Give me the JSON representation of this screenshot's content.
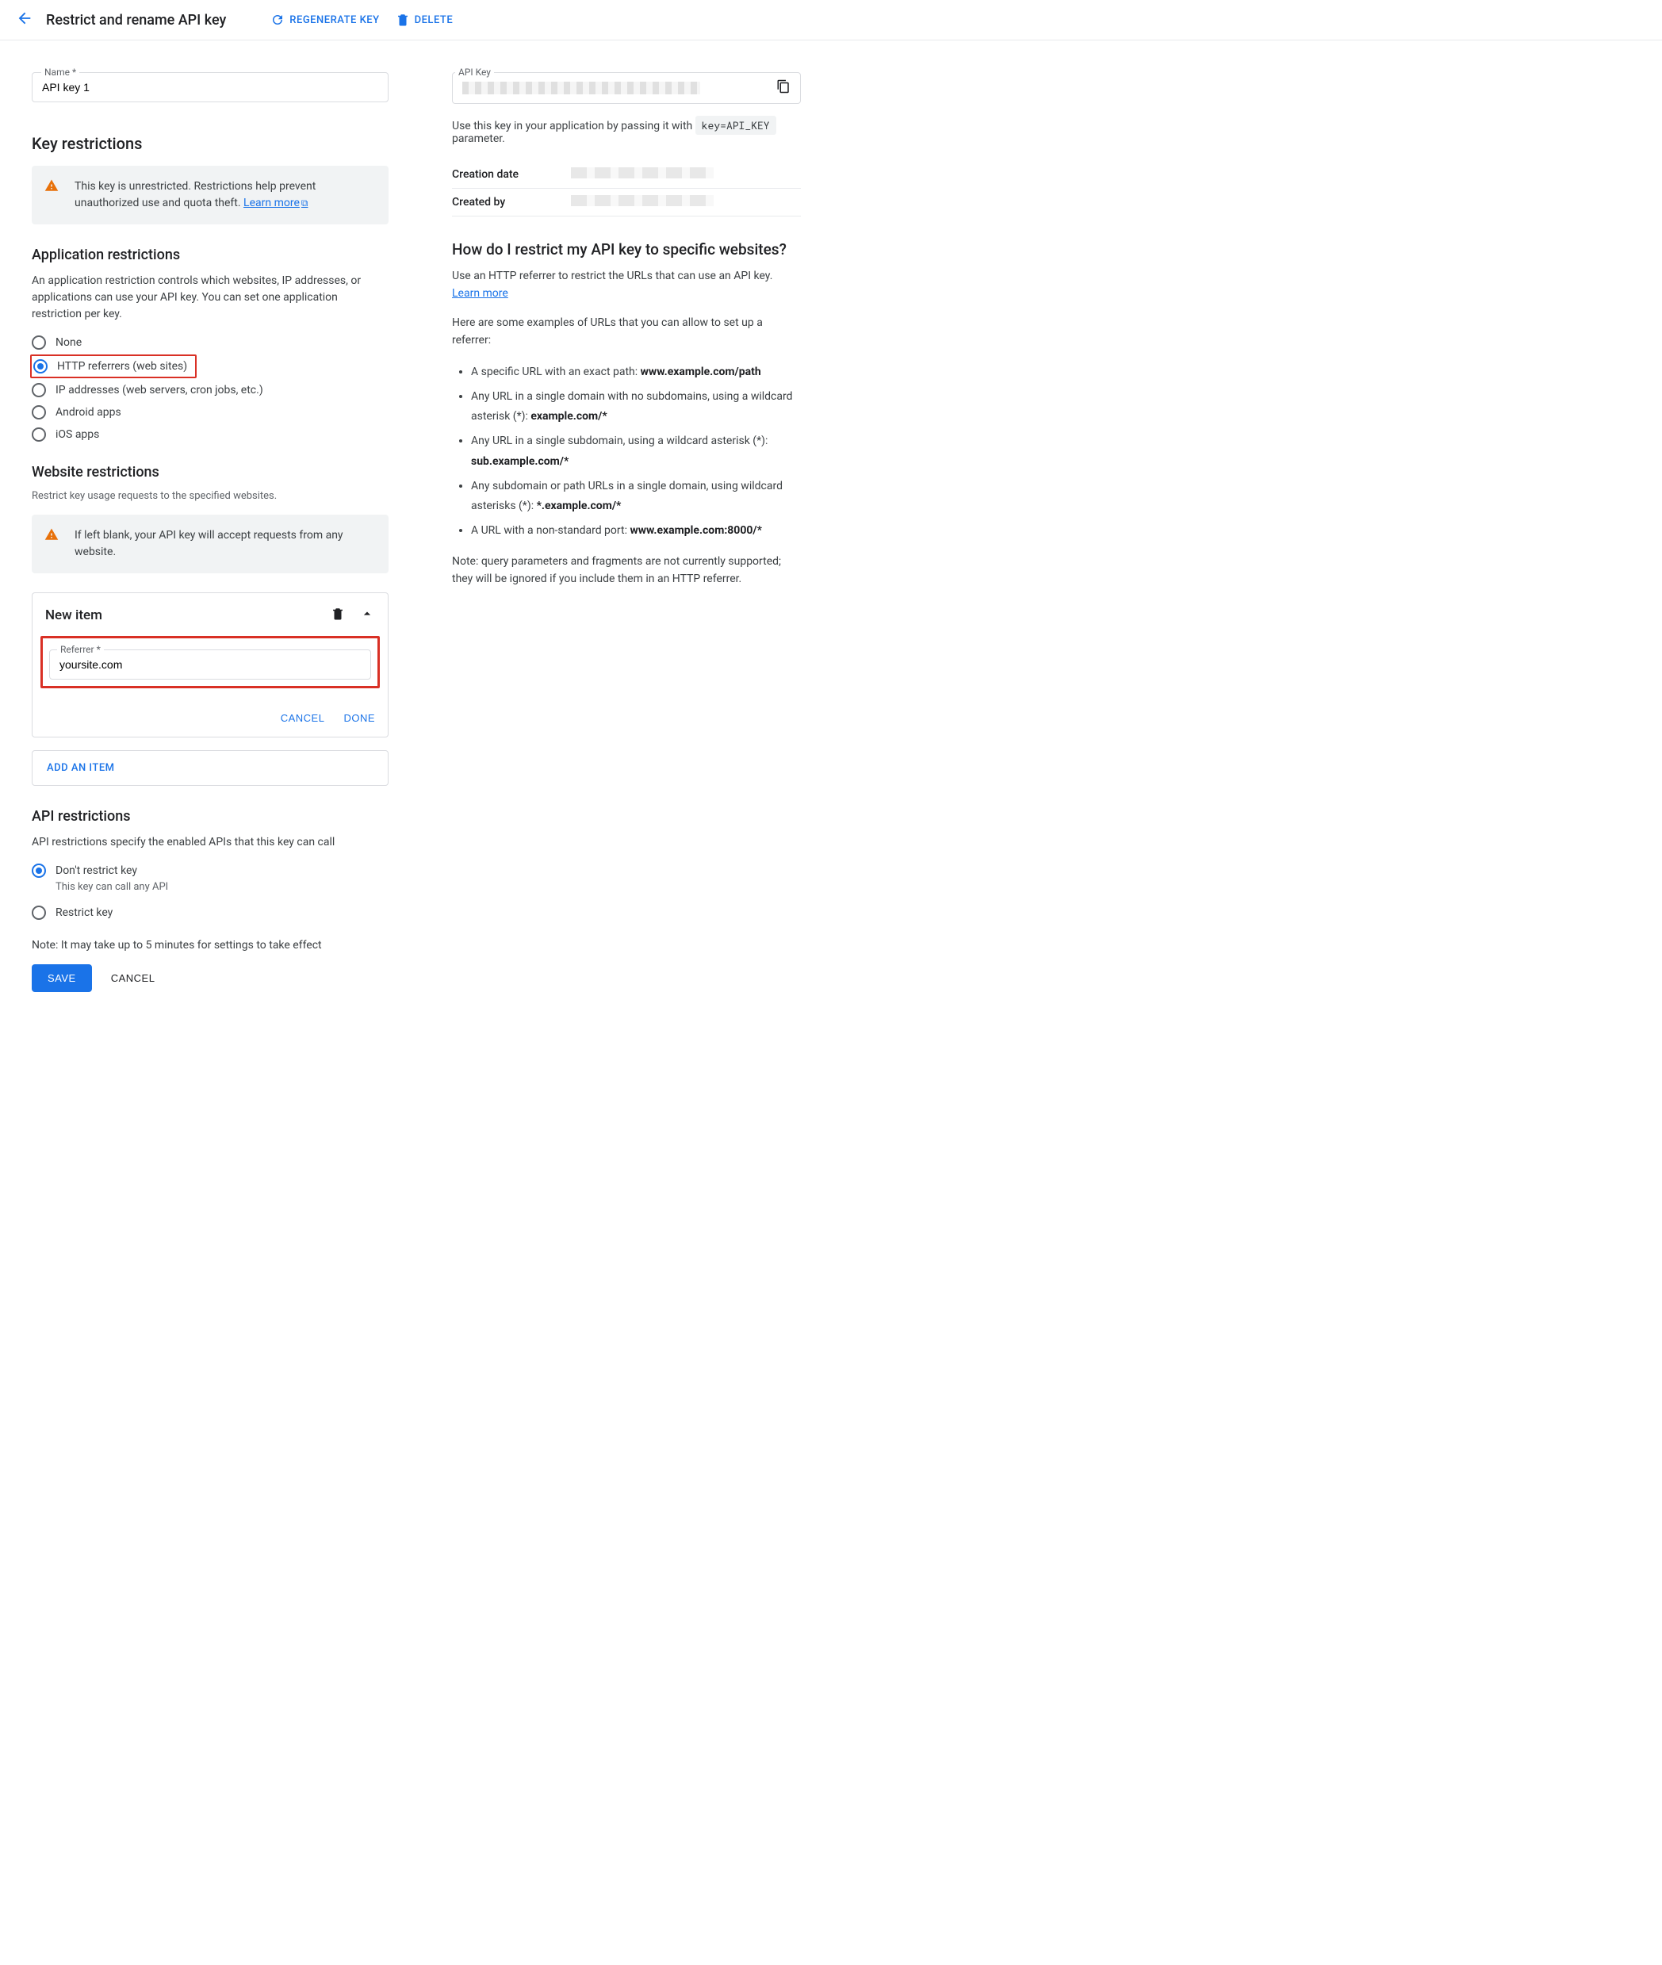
{
  "header": {
    "title": "Restrict and rename API key",
    "regenerate": "REGENERATE KEY",
    "delete": "DELETE"
  },
  "name_field": {
    "label": "Name *",
    "value": "API key 1"
  },
  "key_restrictions": {
    "heading": "Key restrictions",
    "warning_text": "This key is unrestricted. Restrictions help prevent unauthorized use and quota theft. ",
    "learn_more": "Learn more"
  },
  "app_restrictions": {
    "heading": "Application restrictions",
    "desc": "An application restriction controls which websites, IP addresses, or applications can use your API key. You can set one application restriction per key.",
    "options": [
      {
        "label": "None",
        "checked": false
      },
      {
        "label": "HTTP referrers (web sites)",
        "checked": true,
        "highlighted": true
      },
      {
        "label": "IP addresses (web servers, cron jobs, etc.)",
        "checked": false
      },
      {
        "label": "Android apps",
        "checked": false
      },
      {
        "label": "iOS apps",
        "checked": false
      }
    ]
  },
  "website_restrictions": {
    "heading": "Website restrictions",
    "sub": "Restrict key usage requests to the specified websites.",
    "warning": "If left blank, your API key will accept requests from any website.",
    "new_item": {
      "title": "New item",
      "referrer_label": "Referrer *",
      "referrer_value": "yoursite.com",
      "cancel": "CANCEL",
      "done": "DONE"
    },
    "add_item": "ADD AN ITEM"
  },
  "api_restrictions": {
    "heading": "API restrictions",
    "desc": "API restrictions specify the enabled APIs that this key can call",
    "options": [
      {
        "label": "Don't restrict key",
        "sub": "This key can call any API",
        "checked": true
      },
      {
        "label": "Restrict key",
        "checked": false
      }
    ],
    "note": "Note: It may take up to 5 minutes for settings to take effect"
  },
  "footer": {
    "save": "SAVE",
    "cancel": "CANCEL"
  },
  "right": {
    "api_key_label": "API Key",
    "usage_pre": "Use this key in your application by passing it with ",
    "usage_code": "key=API_KEY",
    "usage_post": " parameter.",
    "creation_date_label": "Creation date",
    "created_by_label": "Created by",
    "help_heading": "How do I restrict my API key to specific websites?",
    "help_p1_pre": "Use an HTTP referrer to restrict the URLs that can use an API key. ",
    "help_p1_link": "Learn more",
    "help_p2": "Here are some examples of URLs that you can allow to set up a referrer:",
    "examples": [
      {
        "text": "A specific URL with an exact path: ",
        "bold": "www.example.com/path"
      },
      {
        "text": "Any URL in a single domain with no subdomains, using a wildcard asterisk (*): ",
        "bold": "example.com/*"
      },
      {
        "text": "Any URL in a single subdomain, using a wildcard asterisk (*): ",
        "bold": "sub.example.com/*"
      },
      {
        "text": "Any subdomain or path URLs in a single domain, using wildcard asterisks (*): ",
        "bold": "*.example.com/*"
      },
      {
        "text": "A URL with a non-standard port: ",
        "bold": "www.example.com:8000/*"
      }
    ],
    "help_note": "Note: query parameters and fragments are not currently supported; they will be ignored if you include them in an HTTP referrer."
  }
}
